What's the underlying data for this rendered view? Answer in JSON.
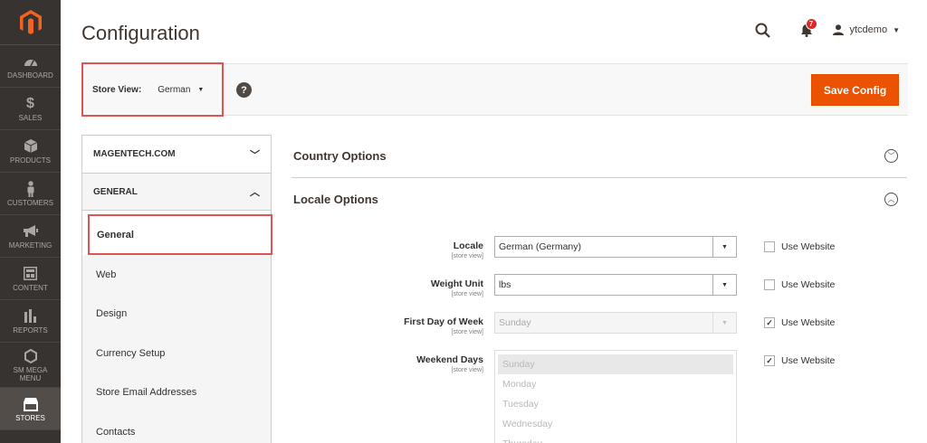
{
  "nav": {
    "items": [
      {
        "label": "Dashboard",
        "icon": "dashboard-icon"
      },
      {
        "label": "Sales",
        "icon": "dollar-icon"
      },
      {
        "label": "Products",
        "icon": "box-icon"
      },
      {
        "label": "Customers",
        "icon": "person-icon"
      },
      {
        "label": "Marketing",
        "icon": "megaphone-icon"
      },
      {
        "label": "Content",
        "icon": "layout-icon"
      },
      {
        "label": "Reports",
        "icon": "bar-chart-icon"
      },
      {
        "label": "SM Mega Menu",
        "icon": "hexagon-icon"
      },
      {
        "label": "Stores",
        "icon": "store-icon"
      }
    ]
  },
  "header": {
    "title": "Configuration",
    "notifications_count": "7",
    "username": "ytcdemo"
  },
  "toolbar": {
    "store_view_label": "Store View:",
    "store_view_value": "German",
    "help": "?",
    "save_label": "Save Config"
  },
  "tabs": {
    "group1": "MAGENTECH.COM",
    "group2": "GENERAL",
    "items": [
      "General",
      "Web",
      "Design",
      "Currency Setup",
      "Store Email Addresses",
      "Contacts"
    ]
  },
  "sections": {
    "country": "Country Options",
    "locale": "Locale Options"
  },
  "fields": {
    "scope": "[store view]",
    "use_website": "Use Website",
    "locale": {
      "label": "Locale",
      "value": "German (Germany)"
    },
    "weight_unit": {
      "label": "Weight Unit",
      "value": "lbs"
    },
    "first_day": {
      "label": "First Day of Week",
      "value": "Sunday"
    },
    "weekend_days": {
      "label": "Weekend Days",
      "options": [
        "Sunday",
        "Monday",
        "Tuesday",
        "Wednesday",
        "Thursday"
      ]
    }
  },
  "colors": {
    "accent": "#eb5202",
    "highlight": "#e05355",
    "nav_bg": "#373330"
  }
}
